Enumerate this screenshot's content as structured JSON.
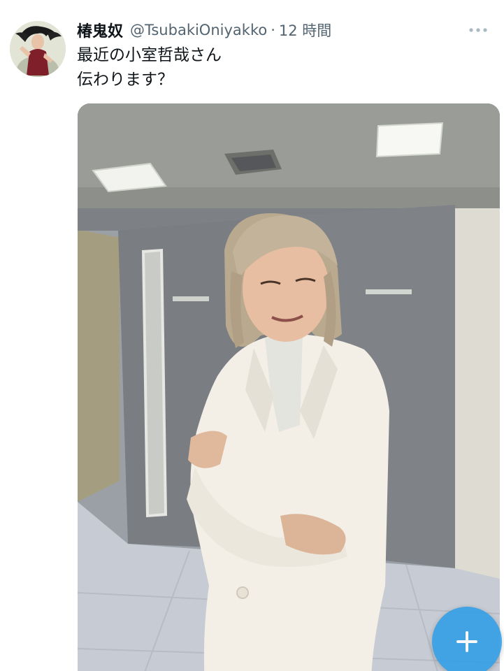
{
  "tweet": {
    "display_name": "椿鬼奴",
    "handle": "@TsubakiOniyakko",
    "separator": "·",
    "timestamp": "12 時間",
    "text_lines": [
      "最近の小室哲哉さん",
      "伝わります？"
    ]
  },
  "icons": {
    "more": "more-horizontal-icon",
    "compose": "plus-icon"
  },
  "colors": {
    "text_primary": "#0f1419",
    "text_secondary": "#536471",
    "fab": "#2f9ee6"
  }
}
